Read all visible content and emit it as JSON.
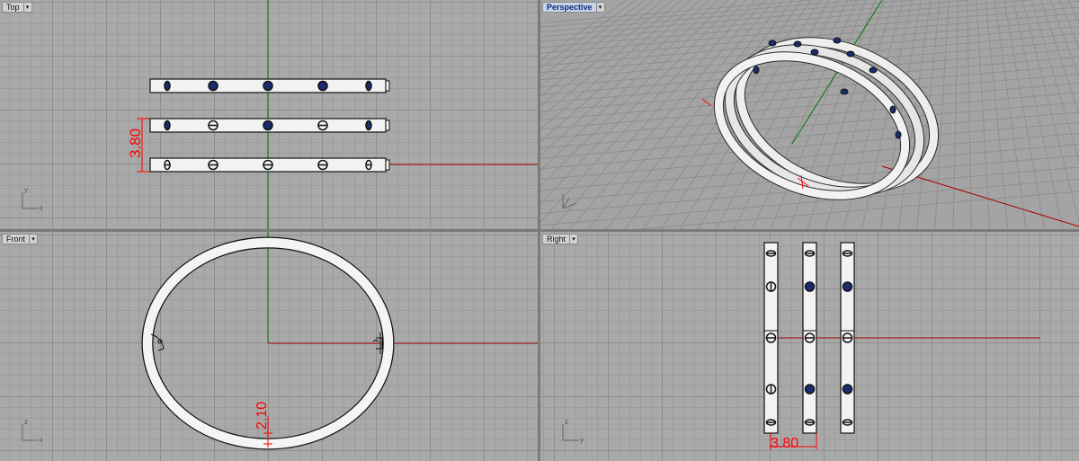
{
  "viewports": {
    "top": {
      "label": "Top"
    },
    "perspective": {
      "label": "Perspective"
    },
    "front": {
      "label": "Front"
    },
    "right": {
      "label": "Right"
    }
  },
  "dimensions": {
    "top_spacing": "3.80",
    "front_thickness": "2.10",
    "right_spacing": "3.80"
  },
  "axis_labels": {
    "y": "y",
    "x": "x",
    "z": "z"
  },
  "colors": {
    "x_axis": "#a80000",
    "y_axis": "#007a00",
    "dimension": "#ff0000",
    "active_tab": "#0b2a7a"
  }
}
